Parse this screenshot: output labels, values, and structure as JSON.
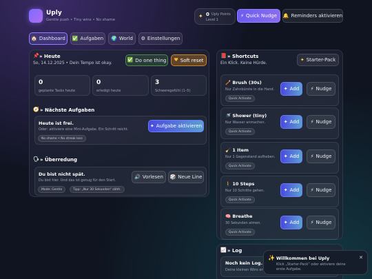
{
  "app": {
    "name": "Uply",
    "tagline": "Gentle push • Tiny wins • No shame",
    "points_value": "0",
    "points_label": "Uply Points",
    "level": "Level 1",
    "quick_nudge": "Quick Nudge",
    "reminders": "Reminders aktivieren"
  },
  "tabs": [
    "Dashboard",
    "Aufgaben",
    "World",
    "Einstellungen"
  ],
  "today": {
    "title": "» Heute",
    "date_line": "So, 14.12.2025 • Dein Tempo ist okay.",
    "do_one": "Do one thing",
    "soft_reset": "Soft reset",
    "stats": [
      {
        "value": "0",
        "label": "geplante Tasks heute"
      },
      {
        "value": "0",
        "label": "erledigt heute"
      },
      {
        "value": "3",
        "label": "Schweregefühl (1–5)"
      }
    ]
  },
  "next": {
    "title": "» Nächste Aufgaben",
    "card_title": "Heute ist frei.",
    "card_text": "Oder: aktiviere eine Mini-Aufgabe. Ein Schritt reicht.",
    "pill": "No shame • No streak loss",
    "button": "Aufgabe aktivieren"
  },
  "persuasion": {
    "title": "» Überredung",
    "card_title": "Du bist nicht spät.",
    "card_text": "Du bist hier. Und das ist genug für den Start.",
    "pill_mode": "Mode: Gentle",
    "pill_tip": "Tipp: „Nur 30 Sekunden“ zählt.",
    "read_aloud": "Vorlesen",
    "new_line": "Neue Line"
  },
  "shortcuts": {
    "title": "» Shortcuts",
    "subtitle": "Ein Klick. Keine Hürde.",
    "starter": "Starter-Pack",
    "add_label": "Add",
    "nudge_label": "Nudge",
    "quick_label": "Quick Activate",
    "items": [
      {
        "name": "Brush (30s)",
        "desc": "Nur Zahnbürste in die Hand."
      },
      {
        "name": "Shower (tiny)",
        "desc": "Nur Wasser anmachen."
      },
      {
        "name": "1 Item",
        "desc": "Nur 1 Gegenstand aufheben."
      },
      {
        "name": "10 Steps",
        "desc": "Nur 10 Schritte gehen."
      },
      {
        "name": "Breathe",
        "desc": "30 Sekunden atmen."
      }
    ]
  },
  "log": {
    "title": "» Log",
    "card_title": "Noch kein Log.",
    "card_text": "Deine kleinen Wins er"
  },
  "toast": {
    "title": "Willkommen bei Uply",
    "text": "Klick „Starter-Pack“ oder aktiviere deine erste Aufgabe."
  },
  "colors": {
    "accent": "#7d6cff",
    "background": "#0f1420",
    "orange": "#c8862a"
  }
}
